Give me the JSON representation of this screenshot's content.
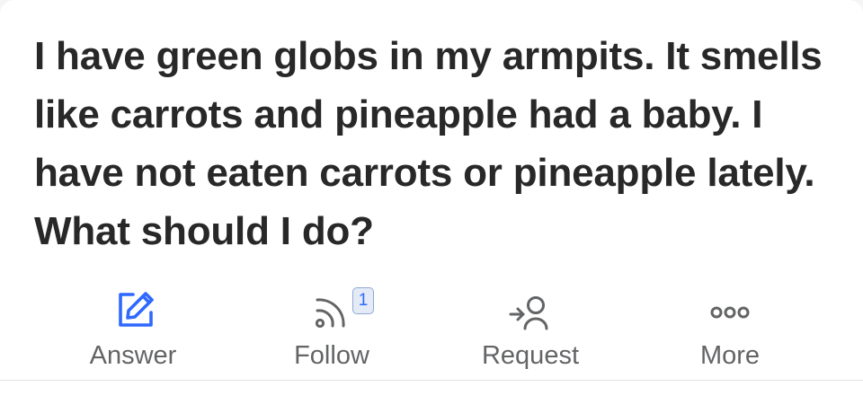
{
  "question": {
    "text": "I have green globs in my armpits. It smells like carrots and pineapple had a baby. I have not eaten carrots or pineapple lately. What should I do?"
  },
  "actions": {
    "answer": {
      "label": "Answer",
      "icon": "pencil-square-icon",
      "color": "#2e69ff"
    },
    "follow": {
      "label": "Follow",
      "icon": "rss-feed-icon",
      "badge": "1",
      "badge_color": "#2e69ff"
    },
    "request": {
      "label": "Request",
      "icon": "person-arrow-icon"
    },
    "more": {
      "label": "More",
      "icon": "three-dots-icon"
    }
  },
  "colors": {
    "text": "#282829",
    "muted": "#636466",
    "accent": "#2e69ff"
  }
}
